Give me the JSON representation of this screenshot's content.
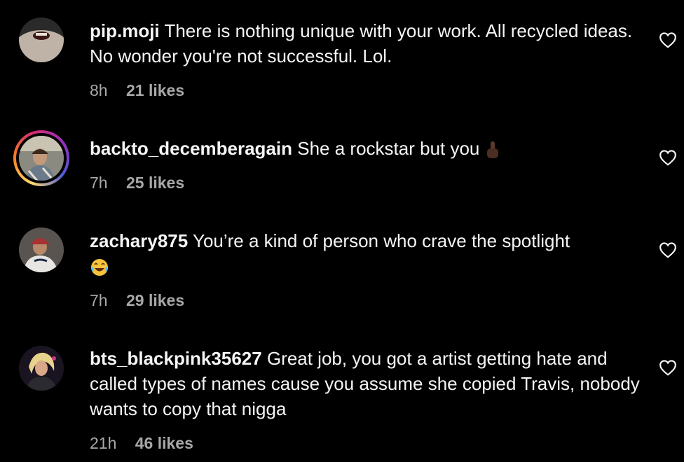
{
  "comments": [
    {
      "username": "pip.moji",
      "text": "There is nothing unique with your work. All recycled ideas. No wonder you're not successful. Lol.",
      "time": "8h",
      "likes": "21 likes",
      "avatar_icon": "avatar-mouth-photo"
    },
    {
      "username": "backto_decemberagain",
      "text": "She a rockstar but you",
      "emoji": "middle-finger-emoji",
      "time": "7h",
      "likes": "25 likes",
      "avatar_icon": "avatar-person-photo",
      "story_ring": true
    },
    {
      "username": "zachary875",
      "text": "You’re a kind of person who crave the spotlight",
      "emoji": "laughing-emoji",
      "time": "7h",
      "likes": "29 likes",
      "avatar_icon": "avatar-baseball-player-photo"
    },
    {
      "username": "bts_blackpink35627",
      "text": "Great job, you got a artist getting hate and called types of names cause you assume she copied Travis, nobody wants to copy that nigga",
      "time": "21h",
      "likes": "46 likes",
      "avatar_icon": "avatar-performer-photo"
    }
  ],
  "colors": {
    "background": "#000000",
    "text": "#f5f5f5",
    "meta": "#a8a8a8"
  }
}
